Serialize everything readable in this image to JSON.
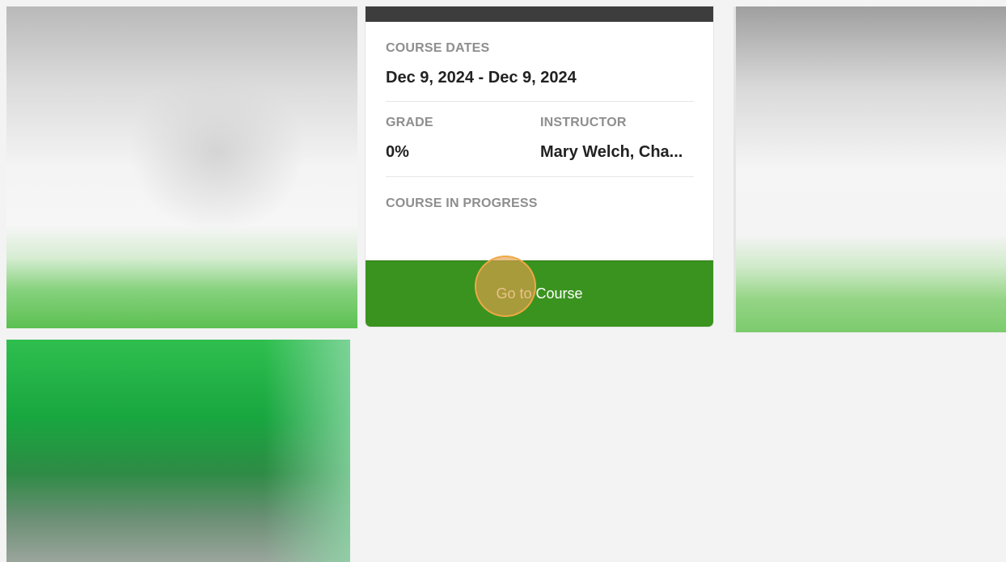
{
  "course_card": {
    "dates_label": "COURSE DATES",
    "dates_value": "Dec 9, 2024 - Dec 9, 2024",
    "grade_label": "GRADE",
    "grade_value": "0%",
    "instructor_label": "INSTRUCTOR",
    "instructor_value": "Mary Welch, Cha...",
    "status": "COURSE IN PROGRESS",
    "button_label": "Go to Course"
  },
  "colors": {
    "button_green": "#3a931f",
    "card_topbar": "#3d3d3d",
    "click_highlight": "#e2a04b",
    "page_background": "#f3f3f3"
  },
  "thumbnails": {
    "left_top": "blurred-course-image",
    "right_top": "blurred-course-image",
    "left_bottom": "blurred-course-image"
  }
}
